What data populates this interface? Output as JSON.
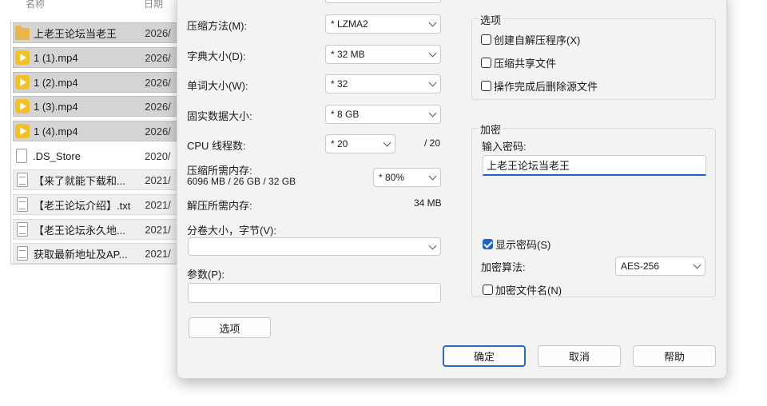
{
  "explorer": {
    "col_name": "名称",
    "col_date": "日期",
    "files": [
      {
        "name": "上老王论坛当老王",
        "date": "2026/",
        "icon": "folder-icon",
        "state": "selected"
      },
      {
        "name": "1 (1).mp4",
        "date": "2026/",
        "icon": "video-icon",
        "state": "selected"
      },
      {
        "name": "1 (2).mp4",
        "date": "2026/",
        "icon": "video-icon",
        "state": "selected"
      },
      {
        "name": "1 (3).mp4",
        "date": "2026/",
        "icon": "video-icon",
        "state": "selected"
      },
      {
        "name": "1 (4).mp4",
        "date": "2026/",
        "icon": "video-icon",
        "state": "selected"
      },
      {
        "name": ".DS_Store",
        "date": "2020/",
        "icon": "file-icon",
        "state": "normal"
      },
      {
        "name": "【来了就能下载和...",
        "date": "2021/",
        "icon": "text-file-icon",
        "state": "plain"
      },
      {
        "name": "【老王论坛介绍】.txt",
        "date": "2021/",
        "icon": "text-file-icon",
        "state": "plain"
      },
      {
        "name": "【老王论坛永久地...",
        "date": "2021/",
        "icon": "text-file-icon",
        "state": "plain"
      },
      {
        "name": "获取最新地址及AP...",
        "date": "2021/",
        "icon": "text-file-icon",
        "state": "plain"
      }
    ]
  },
  "dialog": {
    "compression_method": {
      "label": "压缩方法(M):",
      "value": "* LZMA2"
    },
    "dictionary_size": {
      "label": "字典大小(D):",
      "value": "* 32 MB"
    },
    "word_size": {
      "label": "单词大小(W):",
      "value": "* 32"
    },
    "solid_block_size": {
      "label": "固实数据大小:",
      "value": "* 8 GB"
    },
    "cpu_threads": {
      "label": "CPU 线程数:",
      "value": "* 20",
      "max": "/ 20"
    },
    "memory_compress": {
      "label": "压缩所需内存:",
      "detail": "6096 MB / 26 GB / 32 GB",
      "value": "* 80%"
    },
    "memory_decompress": {
      "label": "解压所需内存:",
      "value": "34 MB"
    },
    "split_volumes": {
      "label": "分卷大小，字节(V):",
      "value": ""
    },
    "parameters": {
      "label": "参数(P):",
      "value": ""
    },
    "options_button": "选项",
    "options_group": {
      "title": "选项",
      "create_sfx": "创建自解压程序(X)",
      "compress_shared": "压缩共享文件",
      "delete_after": "操作完成后删除源文件"
    },
    "encryption_group": {
      "title": "加密",
      "password_label": "输入密码:",
      "password_value": "上老王论坛当老王",
      "show_password": "显示密码(S)",
      "method_label": "加密算法:",
      "method_value": "AES-256",
      "encrypt_names": "加密文件名(N)"
    },
    "buttons": {
      "ok": "确定",
      "cancel": "取消",
      "help": "帮助"
    },
    "colors": {
      "accent": "#1e63c4",
      "dialog_bg": "#f3f3f3"
    }
  }
}
